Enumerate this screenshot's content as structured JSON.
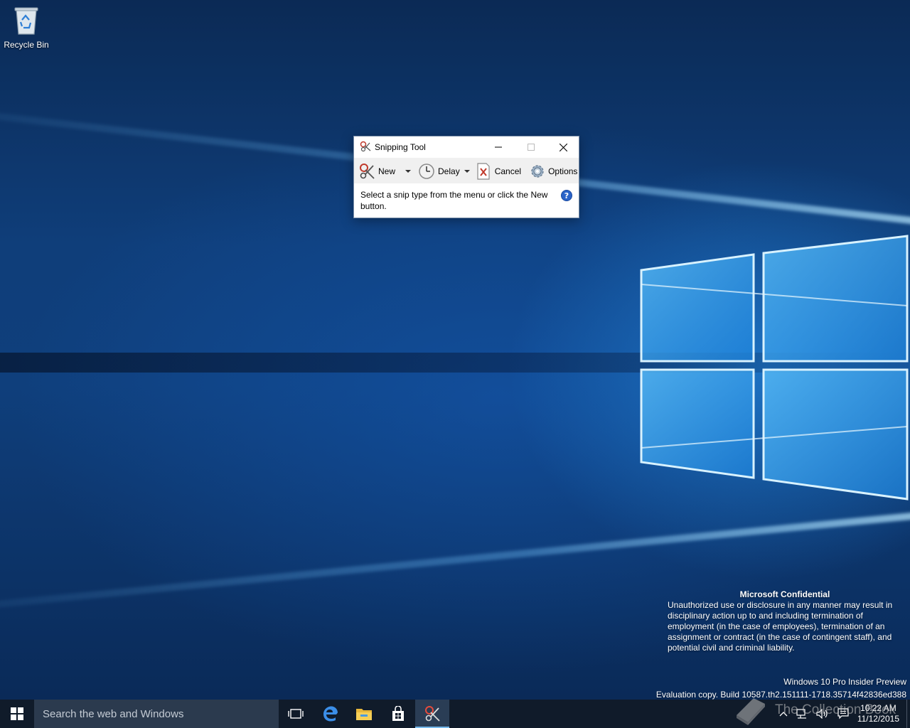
{
  "desktop": {
    "icons": [
      {
        "label": "Recycle Bin",
        "icon": "recycle-bin-icon"
      }
    ]
  },
  "snipping_tool": {
    "title": "Snipping Tool",
    "toolbar": {
      "new_label": "New",
      "delay_label": "Delay",
      "cancel_label": "Cancel",
      "options_label": "Options"
    },
    "message": "Select a snip type from the menu or click the New button."
  },
  "confidential": {
    "title": "Microsoft Confidential",
    "body": "Unauthorized use or disclosure in any manner may result in disciplinary action up to and including termination of employment (in the case of employees), termination of an assignment or contract (in the case of contingent staff), and potential civil and criminal liability."
  },
  "build_info": {
    "edition": "Windows 10 Pro Insider Preview",
    "build": "Evaluation copy. Build 10587.th2.151111-1718.35714f42836ed388"
  },
  "taskbar": {
    "search_placeholder": "Search the web and Windows",
    "pinned": [
      "task-view-icon",
      "edge-icon",
      "file-explorer-icon",
      "store-icon",
      "snipping-tool-icon"
    ],
    "clock_time": "10:22 AM",
    "clock_date": "11/12/2015"
  },
  "watermark": {
    "text": "The Collection Book"
  },
  "colors": {
    "taskbar": "#101b2a",
    "accent": "#76b9ed",
    "search_box": "#2b3a4e"
  }
}
